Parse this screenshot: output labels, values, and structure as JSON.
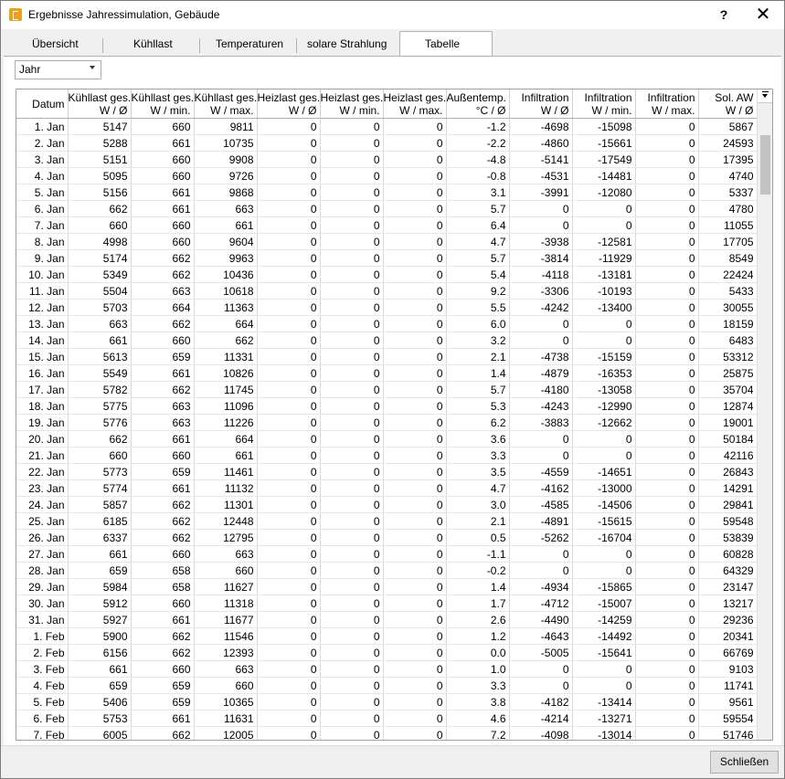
{
  "window": {
    "title": "Ergebnisse Jahressimulation, Gebäude",
    "help_label": "?",
    "close_label": "✕"
  },
  "tabs": [
    {
      "label": "Übersicht"
    },
    {
      "label": "Kühllast"
    },
    {
      "label": "Temperaturen"
    },
    {
      "label": "solare Strahlung"
    },
    {
      "label": "Tabelle"
    }
  ],
  "period_select": {
    "value": "Jahr"
  },
  "table": {
    "columns": [
      [
        "Datum",
        ""
      ],
      [
        "Kühllast ges.",
        "W / Ø"
      ],
      [
        "Kühllast ges.",
        "W / min."
      ],
      [
        "Kühllast ges.",
        "W / max."
      ],
      [
        "Heizlast ges.",
        "W / Ø"
      ],
      [
        "Heizlast ges.",
        "W / min."
      ],
      [
        "Heizlast ges.",
        "W / max."
      ],
      [
        "Außentemp.",
        "°C / Ø"
      ],
      [
        "Infiltration",
        "W / Ø"
      ],
      [
        "Infiltration",
        "W / min."
      ],
      [
        "Infiltration",
        "W / max."
      ],
      [
        "Sol. AW",
        "W / Ø"
      ]
    ],
    "rows": [
      [
        "1. Jan",
        "5147",
        "660",
        "9811",
        "0",
        "0",
        "0",
        "-1.2",
        "-4698",
        "-15098",
        "0",
        "5867"
      ],
      [
        "2. Jan",
        "5288",
        "661",
        "10735",
        "0",
        "0",
        "0",
        "-2.2",
        "-4860",
        "-15661",
        "0",
        "24593"
      ],
      [
        "3. Jan",
        "5151",
        "660",
        "9908",
        "0",
        "0",
        "0",
        "-4.8",
        "-5141",
        "-17549",
        "0",
        "17395"
      ],
      [
        "4. Jan",
        "5095",
        "660",
        "9726",
        "0",
        "0",
        "0",
        "-0.8",
        "-4531",
        "-14481",
        "0",
        "4740"
      ],
      [
        "5. Jan",
        "5156",
        "661",
        "9868",
        "0",
        "0",
        "0",
        "3.1",
        "-3991",
        "-12080",
        "0",
        "5337"
      ],
      [
        "6. Jan",
        "662",
        "661",
        "663",
        "0",
        "0",
        "0",
        "5.7",
        "0",
        "0",
        "0",
        "4780"
      ],
      [
        "7. Jan",
        "660",
        "660",
        "661",
        "0",
        "0",
        "0",
        "6.4",
        "0",
        "0",
        "0",
        "11055"
      ],
      [
        "8. Jan",
        "4998",
        "660",
        "9604",
        "0",
        "0",
        "0",
        "4.7",
        "-3938",
        "-12581",
        "0",
        "17705"
      ],
      [
        "9. Jan",
        "5174",
        "662",
        "9963",
        "0",
        "0",
        "0",
        "5.7",
        "-3814",
        "-11929",
        "0",
        "8549"
      ],
      [
        "10. Jan",
        "5349",
        "662",
        "10436",
        "0",
        "0",
        "0",
        "5.4",
        "-4118",
        "-13181",
        "0",
        "22424"
      ],
      [
        "11. Jan",
        "5504",
        "663",
        "10618",
        "0",
        "0",
        "0",
        "9.2",
        "-3306",
        "-10193",
        "0",
        "5433"
      ],
      [
        "12. Jan",
        "5703",
        "664",
        "11363",
        "0",
        "0",
        "0",
        "5.5",
        "-4242",
        "-13400",
        "0",
        "30055"
      ],
      [
        "13. Jan",
        "663",
        "662",
        "664",
        "0",
        "0",
        "0",
        "6.0",
        "0",
        "0",
        "0",
        "18159"
      ],
      [
        "14. Jan",
        "661",
        "660",
        "662",
        "0",
        "0",
        "0",
        "3.2",
        "0",
        "0",
        "0",
        "6483"
      ],
      [
        "15. Jan",
        "5613",
        "659",
        "11331",
        "0",
        "0",
        "0",
        "2.1",
        "-4738",
        "-15159",
        "0",
        "53312"
      ],
      [
        "16. Jan",
        "5549",
        "661",
        "10826",
        "0",
        "0",
        "0",
        "1.4",
        "-4879",
        "-16353",
        "0",
        "25875"
      ],
      [
        "17. Jan",
        "5782",
        "662",
        "11745",
        "0",
        "0",
        "0",
        "5.7",
        "-4180",
        "-13058",
        "0",
        "35704"
      ],
      [
        "18. Jan",
        "5775",
        "663",
        "11096",
        "0",
        "0",
        "0",
        "5.3",
        "-4243",
        "-12990",
        "0",
        "12874"
      ],
      [
        "19. Jan",
        "5776",
        "663",
        "11226",
        "0",
        "0",
        "0",
        "6.2",
        "-3883",
        "-12662",
        "0",
        "19001"
      ],
      [
        "20. Jan",
        "662",
        "661",
        "664",
        "0",
        "0",
        "0",
        "3.6",
        "0",
        "0",
        "0",
        "50184"
      ],
      [
        "21. Jan",
        "660",
        "660",
        "661",
        "0",
        "0",
        "0",
        "3.3",
        "0",
        "0",
        "0",
        "42116"
      ],
      [
        "22. Jan",
        "5773",
        "659",
        "11461",
        "0",
        "0",
        "0",
        "3.5",
        "-4559",
        "-14651",
        "0",
        "26843"
      ],
      [
        "23. Jan",
        "5774",
        "661",
        "11132",
        "0",
        "0",
        "0",
        "4.7",
        "-4162",
        "-13000",
        "0",
        "14291"
      ],
      [
        "24. Jan",
        "5857",
        "662",
        "11301",
        "0",
        "0",
        "0",
        "3.0",
        "-4585",
        "-14506",
        "0",
        "29841"
      ],
      [
        "25. Jan",
        "6185",
        "662",
        "12448",
        "0",
        "0",
        "0",
        "2.1",
        "-4891",
        "-15615",
        "0",
        "59548"
      ],
      [
        "26. Jan",
        "6337",
        "662",
        "12795",
        "0",
        "0",
        "0",
        "0.5",
        "-5262",
        "-16704",
        "0",
        "53839"
      ],
      [
        "27. Jan",
        "661",
        "660",
        "663",
        "0",
        "0",
        "0",
        "-1.1",
        "0",
        "0",
        "0",
        "60828"
      ],
      [
        "28. Jan",
        "659",
        "658",
        "660",
        "0",
        "0",
        "0",
        "-0.2",
        "0",
        "0",
        "0",
        "64329"
      ],
      [
        "29. Jan",
        "5984",
        "658",
        "11627",
        "0",
        "0",
        "0",
        "1.4",
        "-4934",
        "-15865",
        "0",
        "23147"
      ],
      [
        "30. Jan",
        "5912",
        "660",
        "11318",
        "0",
        "0",
        "0",
        "1.7",
        "-4712",
        "-15007",
        "0",
        "13217"
      ],
      [
        "31. Jan",
        "5927",
        "661",
        "11677",
        "0",
        "0",
        "0",
        "2.6",
        "-4490",
        "-14259",
        "0",
        "29236"
      ],
      [
        "1. Feb",
        "5900",
        "662",
        "11546",
        "0",
        "0",
        "0",
        "1.2",
        "-4643",
        "-14492",
        "0",
        "20341"
      ],
      [
        "2. Feb",
        "6156",
        "662",
        "12393",
        "0",
        "0",
        "0",
        "0.0",
        "-5005",
        "-15641",
        "0",
        "66769"
      ],
      [
        "3. Feb",
        "661",
        "660",
        "663",
        "0",
        "0",
        "0",
        "1.0",
        "0",
        "0",
        "0",
        "9103"
      ],
      [
        "4. Feb",
        "659",
        "659",
        "660",
        "0",
        "0",
        "0",
        "3.3",
        "0",
        "0",
        "0",
        "11741"
      ],
      [
        "5. Feb",
        "5406",
        "659",
        "10365",
        "0",
        "0",
        "0",
        "3.8",
        "-4182",
        "-13414",
        "0",
        "9561"
      ],
      [
        "6. Feb",
        "5753",
        "661",
        "11631",
        "0",
        "0",
        "0",
        "4.6",
        "-4214",
        "-13271",
        "0",
        "59554"
      ],
      [
        "7. Feb",
        "6005",
        "662",
        "12005",
        "0",
        "0",
        "0",
        "7.2",
        "-4098",
        "-13014",
        "0",
        "51746"
      ]
    ]
  },
  "footer": {
    "close_button_label": "Schließen"
  }
}
